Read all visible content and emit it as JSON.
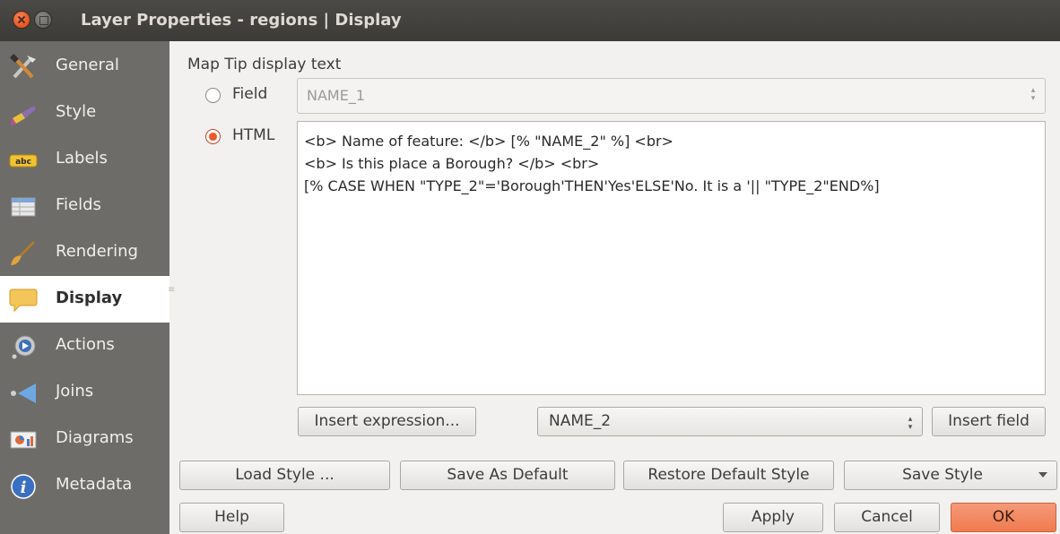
{
  "window": {
    "title": "Layer Properties - regions | Display"
  },
  "sidebar": {
    "items": [
      {
        "label": "General",
        "icon": "tools-icon"
      },
      {
        "label": "Style",
        "icon": "paintbrush-icon"
      },
      {
        "label": "Labels",
        "icon": "abc-label-icon"
      },
      {
        "label": "Fields",
        "icon": "table-icon"
      },
      {
        "label": "Rendering",
        "icon": "brush-icon"
      },
      {
        "label": "Display",
        "icon": "speech-bubble-icon",
        "active": true
      },
      {
        "label": "Actions",
        "icon": "gear-play-icon"
      },
      {
        "label": "Joins",
        "icon": "join-icon"
      },
      {
        "label": "Diagrams",
        "icon": "diagram-icon"
      },
      {
        "label": "Metadata",
        "icon": "info-icon"
      }
    ]
  },
  "main": {
    "section_title": "Map Tip display text",
    "field_option": {
      "label": "Field",
      "value": "NAME_1",
      "checked": false
    },
    "html_option": {
      "label": "HTML",
      "checked": true
    },
    "html_lines": [
      "<b> Name of feature: </b> [% \"NAME_2\" %] <br>",
      "<b> Is this place a Borough? </b> <br>",
      "[% CASE WHEN \"TYPE_2\"='Borough'THEN'Yes'ELSE'No. It is a '|| \"TYPE_2\"END%]"
    ],
    "insert_expression_label": "Insert expression...",
    "field_combo_value": "NAME_2",
    "insert_field_label": "Insert field"
  },
  "footer": {
    "load_style": "Load Style ...",
    "save_as_default": "Save As Default",
    "restore_default": "Restore Default Style",
    "save_style": "Save Style",
    "help": "Help",
    "apply": "Apply",
    "cancel": "Cancel",
    "ok": "OK"
  },
  "colors": {
    "accent": "#e9572a",
    "sidebar_bg": "#6d6c68",
    "titlebar_bg": "#3c3b37",
    "ok_button": "#f07a4f"
  }
}
